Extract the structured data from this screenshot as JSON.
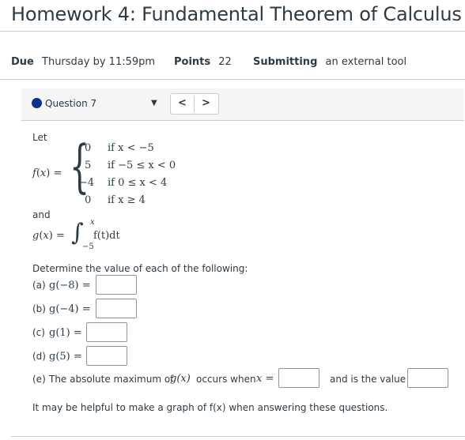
{
  "page": {
    "title": "Homework 4: Fundamental Theorem of Calculus"
  },
  "meta": {
    "due_label": "Due",
    "due_value": "Thursday by 11:59pm",
    "points_label": "Points",
    "points_value": "22",
    "submitting_label": "Submitting",
    "submitting_value": "an external tool"
  },
  "question_nav": {
    "current_question": "Question 7",
    "prev_label": "<",
    "next_label": ">"
  },
  "problem": {
    "let_label": "Let",
    "f_lhs": "f(x) =",
    "pieces": [
      {
        "value": "0",
        "condition": "if  x < −5"
      },
      {
        "value": "5",
        "condition": "if  −5 ≤ x < 0"
      },
      {
        "value": "−4",
        "condition": "if  0 ≤ x < 4"
      },
      {
        "value": "0",
        "condition": "if  x ≥ 4"
      }
    ],
    "and_label": "and",
    "g_lhs": "g(x) =",
    "integral_upper": "x",
    "integral_lower": "−5",
    "integrand": "f(t)dt",
    "instruction": "Determine the value of each of the following:",
    "parts": [
      {
        "label": "(a)",
        "expr": "g(−8) =",
        "value": ""
      },
      {
        "label": "(b)",
        "expr": "g(−4) =",
        "value": ""
      },
      {
        "label": "(c)",
        "expr": "g(1) =",
        "value": ""
      },
      {
        "label": "(d)",
        "expr": "g(5) =",
        "value": ""
      }
    ],
    "part_e_label": "(e)",
    "part_e_text": "The absolute maximum of",
    "part_e_gx": "g(x)",
    "part_e_occurs": "occurs when",
    "part_e_xeq": "x =",
    "part_e_value_text": "and is the value",
    "part_e_x_value": "",
    "part_e_max_value": "",
    "hint": "It may be helpful to make a graph of f(x) when answering these questions."
  },
  "colors": {
    "text": "#2d3b45",
    "divider": "#c7cdd1",
    "question_dot": "#0a2f8f"
  }
}
